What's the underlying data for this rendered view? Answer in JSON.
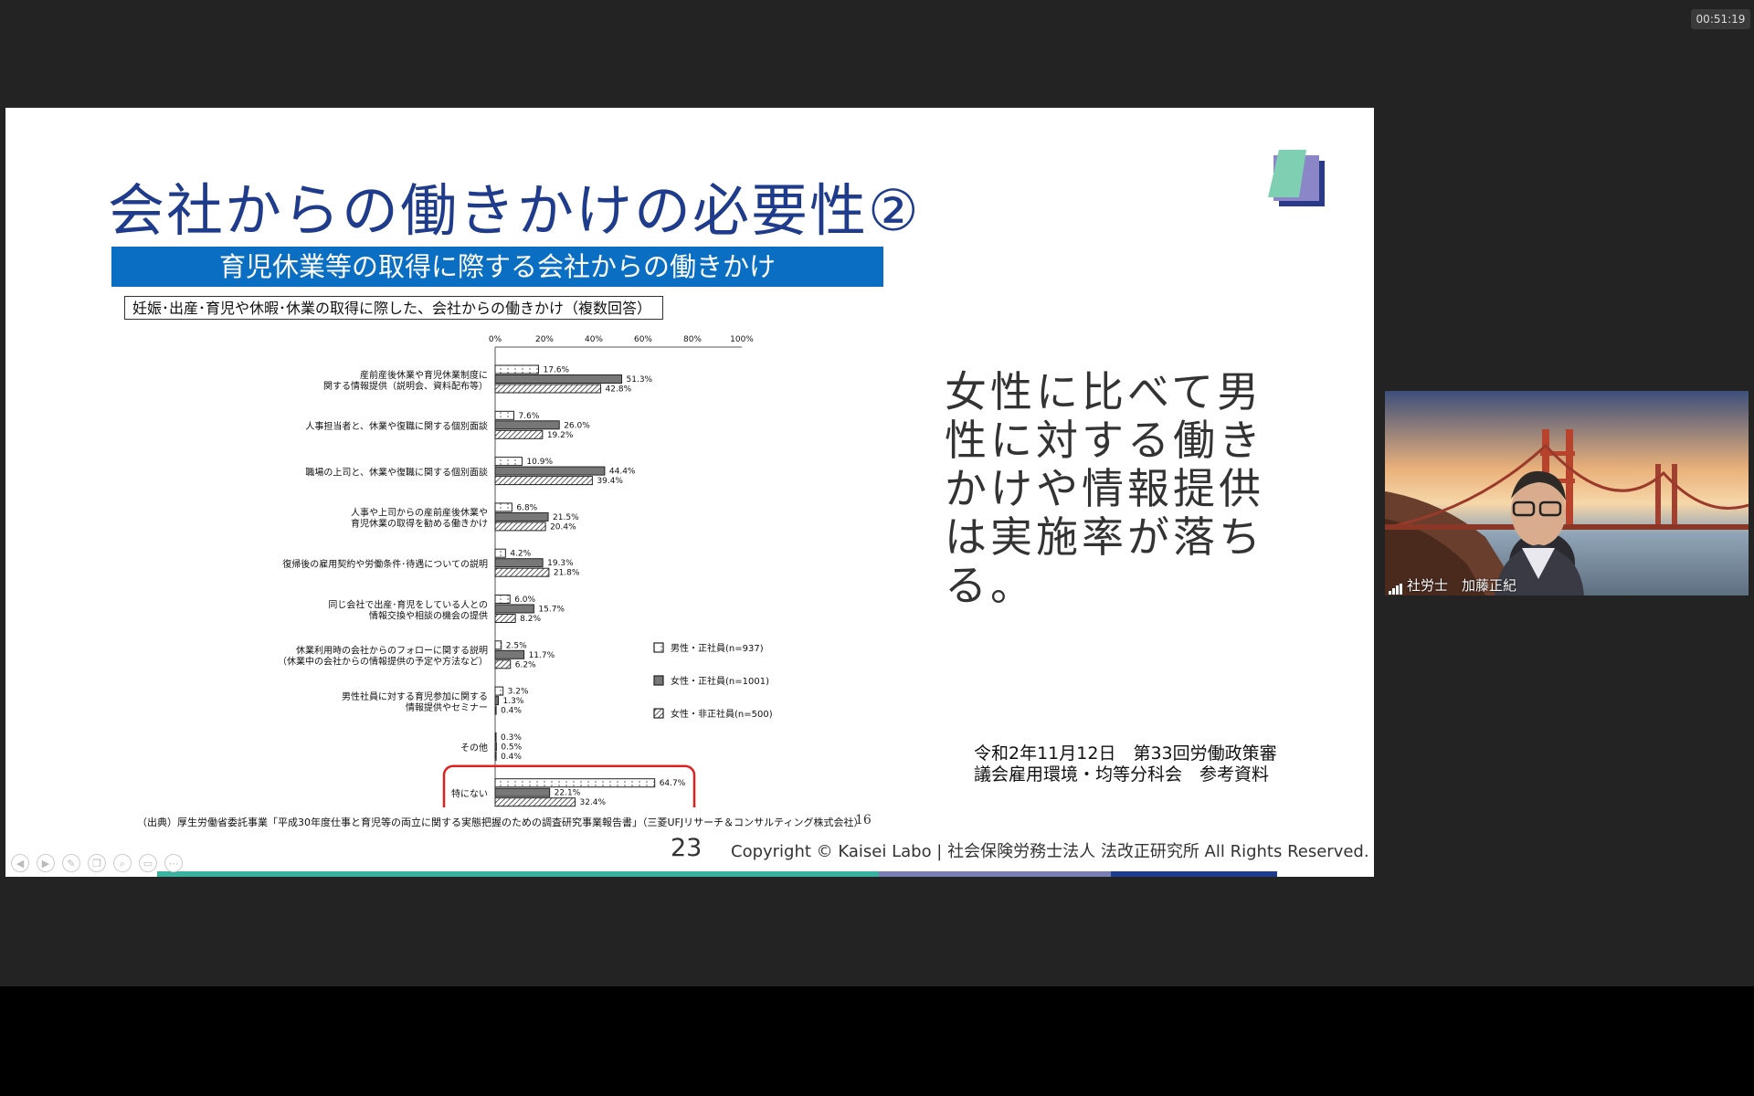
{
  "meeting": {
    "elapsed_time": "00:51:19",
    "participant_name": "社労士　加藤正紀"
  },
  "slide": {
    "title": "会社からの働きかけの必要性②",
    "chart_header": "育児休業等の取得に際する会社からの働きかけ",
    "chart_subtitle": "妊娠･出産･育児や休暇･休業の取得に際した、会社からの働きかけ（複数回答）",
    "source": "（出典）厚生労働省委託事業「平成30年度仕事と育児等の両立に関する実態把握のための調査研究事業報告書」（三菱UFJリサーチ＆コンサルティング株式会社）",
    "inner_page": "16",
    "comment": "女性に比べて男性に対する働きかけや情報提供は実施率が落ちる。",
    "reference_line1": "令和2年11月12日　第33回労働政策審",
    "reference_line2": "議会雇用環境・均等分科会　参考資料",
    "page_number": "23",
    "copyright": "Copyright © Kaisei Labo | 社会保険労務士法人 法改正研究所 All Rights Reserved.",
    "colors": {
      "title": "#1f3c8c",
      "header_bg": "#0a6fc2",
      "highlight": "#e02020",
      "bar_segments": [
        "#3bb2a0",
        "#7a7fb3",
        "#1f3c8c"
      ]
    }
  },
  "chart_data": {
    "type": "bar",
    "orientation": "horizontal",
    "xlim": [
      0,
      100
    ],
    "x_ticks": [
      "0%",
      "20%",
      "40%",
      "60%",
      "80%",
      "100%"
    ],
    "categories": [
      [
        "産前産後休業や育児休業制度に",
        "関する情報提供（説明会、資料配布等）"
      ],
      [
        "人事担当者と、休業や復職に関する個別面談"
      ],
      [
        "職場の上司と、休業や復職に関する個別面談"
      ],
      [
        "人事や上司からの産前産後休業や",
        "育児休業の取得を勧める働きかけ"
      ],
      [
        "復帰後の雇用契約や労働条件･待遇についての説明"
      ],
      [
        "同じ会社で出産･育児をしている人との",
        "情報交換や相談の機会の提供"
      ],
      [
        "休業利用時の会社からのフォローに関する説明",
        "（休業中の会社からの情報提供の予定や方法など）"
      ],
      [
        "男性社員に対する育児参加に関する",
        "情報提供やセミナー"
      ],
      [
        "その他"
      ],
      [
        "特にない"
      ]
    ],
    "series": [
      {
        "name": "男性・正社員(n=937)",
        "values": [
          17.6,
          7.6,
          10.9,
          6.8,
          4.2,
          6.0,
          2.5,
          3.2,
          0.3,
          64.7
        ]
      },
      {
        "name": "女性・正社員(n=1001)",
        "values": [
          51.3,
          26.0,
          44.4,
          21.5,
          19.3,
          15.7,
          11.7,
          1.3,
          0.5,
          22.1
        ]
      },
      {
        "name": "女性・非正社員(n=500)",
        "values": [
          42.8,
          19.2,
          39.4,
          20.4,
          21.8,
          8.2,
          6.2,
          0.4,
          0.4,
          32.4
        ]
      }
    ],
    "highlighted_category": "特にない",
    "legend_position": "right"
  }
}
